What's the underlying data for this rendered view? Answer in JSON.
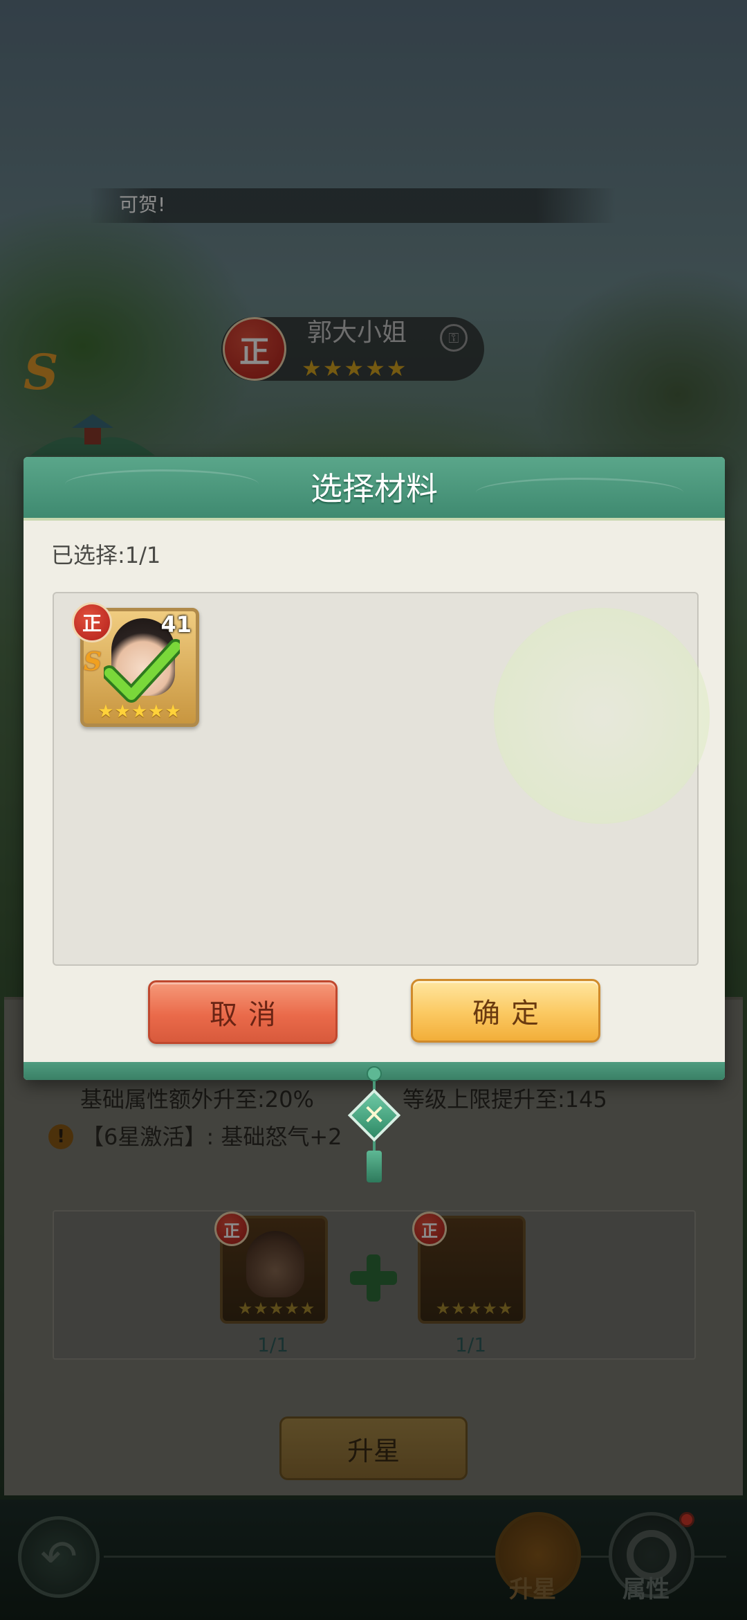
{
  "banner": {
    "text": "可贺!"
  },
  "hero": {
    "badge": "正",
    "name": "郭大小姐",
    "stars": "★★★★★",
    "rank": "S"
  },
  "upgrade_info": {
    "attr_bonus": "基础属性额外升至:20%",
    "level_cap": "等级上限提升至:145",
    "activation": "【6星激活】: 基础怒气+2"
  },
  "materials": {
    "items": [
      {
        "badge": "正",
        "stars": "★★★★★",
        "count": "1/1"
      },
      {
        "badge": "正",
        "stars": "★★★★★",
        "count": "1/1"
      }
    ],
    "upstar_button": "升星"
  },
  "nav": {
    "back_icon": "back-arrow-icon",
    "upstar_label": "升星",
    "attr_label": "属性"
  },
  "dialog": {
    "title": "选择材料",
    "selected": "已选择:1/1",
    "selected_card": {
      "badge": "正",
      "level": "41",
      "rank": "S",
      "stars": "★★★★★"
    },
    "cancel": "取消",
    "confirm": "确定",
    "close_icon": "close-x-icon"
  },
  "colors": {
    "dialog_header": "#4a997c",
    "cancel": "#ea6a4a",
    "confirm": "#fbc860"
  }
}
